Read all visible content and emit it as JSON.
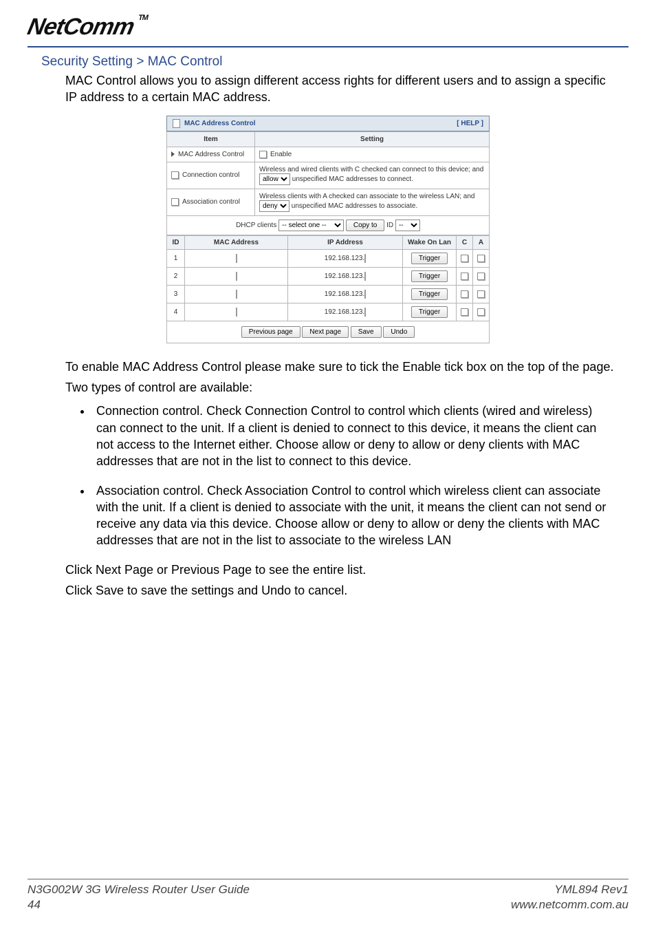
{
  "logo": {
    "text": "NetComm",
    "tm": "TM"
  },
  "breadcrumb": "Security Setting > MAC Control",
  "intro": "MAC Control allows you to assign different access rights for different users and to assign a specific IP address to a certain MAC address.",
  "panel": {
    "title": "MAC Address Control",
    "help": "[ HELP ]",
    "header_item": "Item",
    "header_setting": "Setting",
    "rows": {
      "mac_control_label": "MAC Address Control",
      "enable_label": "Enable",
      "conn_label": "Connection control",
      "conn_text_a": "Wireless and wired clients with C checked can connect to this device; and",
      "conn_select": "allow",
      "conn_text_b": "unspecified MAC addresses to connect.",
      "assoc_label": "Association control",
      "assoc_text_a": "Wireless clients with A checked can associate to the wireless LAN; and",
      "assoc_select": "deny",
      "assoc_text_b": "unspecified MAC addresses to associate."
    },
    "dhcp": {
      "label": "DHCP clients",
      "select": "-- select one --",
      "copy_btn": "Copy to",
      "id_label": "ID",
      "id_select": "--"
    },
    "grid": {
      "headers": {
        "id": "ID",
        "mac": "MAC Address",
        "ip": "IP Address",
        "wol": "Wake On Lan",
        "c": "C",
        "a": "A"
      },
      "ip_prefix": "192.168.123.",
      "trigger": "Trigger",
      "rows": [
        "1",
        "2",
        "3",
        "4"
      ]
    },
    "buttons": {
      "prev": "Previous page",
      "next": "Next page",
      "save": "Save",
      "undo": "Undo"
    }
  },
  "para1": "To enable MAC Address Control please make sure to tick the Enable tick box on the top of the page.",
  "para2": "Two types of control are available:",
  "bullets": [
    "Connection control. Check Connection Control to control which clients (wired and wireless) can connect to the unit. If a client is denied to connect to this device, it means the client can not access to the Internet either. Choose allow or deny to allow or deny clients with MAC addresses that are not in the list to connect to this device.",
    "Association control. Check Association Control to control which wireless client can associate with the unit. If a client is denied to associate with the unit, it means the client can not send or receive any data via this device. Choose allow or deny to allow or deny the clients with MAC addresses that are not in the list to associate to the wireless LAN"
  ],
  "para3": "Click Next Page or Previous Page to see the entire list.",
  "para4": "Click Save to save the settings and Undo to cancel.",
  "footer": {
    "left1": "N3G002W 3G Wireless Router User Guide",
    "left2": "44",
    "right1": "YML894 Rev1",
    "right2": "www.netcomm.com.au"
  }
}
